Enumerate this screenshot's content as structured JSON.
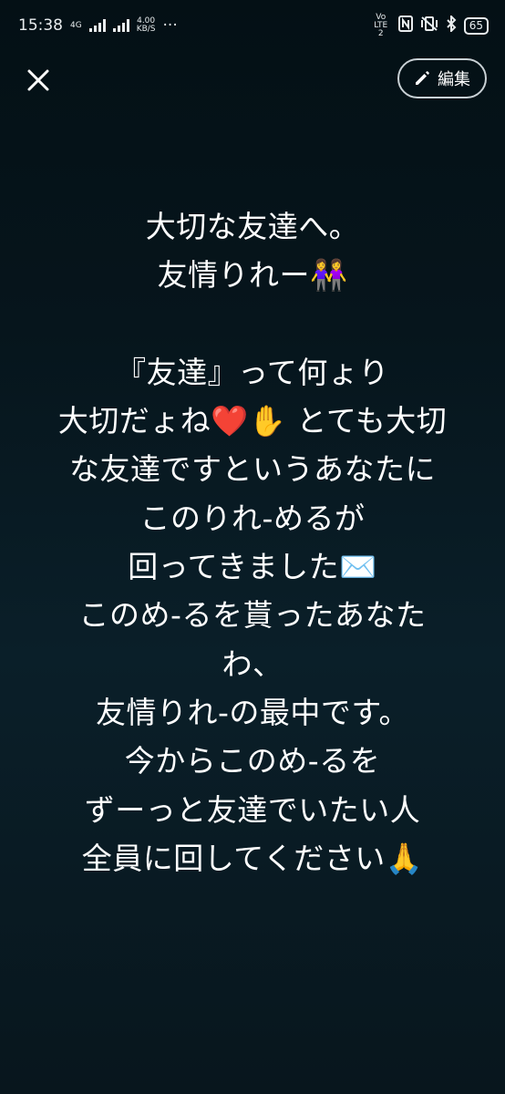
{
  "status_bar": {
    "time": "15:38",
    "network_type": "4G",
    "speed_value": "4.00",
    "speed_unit": "KB/S",
    "more": "···",
    "volte": "Vo LTE 2",
    "battery": "65"
  },
  "top_bar": {
    "edit_label": "編集"
  },
  "message": {
    "lines": [
      "大切な友達へ。",
      "友情りれー👭",
      "",
      "『友達』って何ょり",
      "大切だょね❤️✋ とても大切",
      "な友達ですというあなたに",
      "このりれ-めるが",
      "回ってきました✉️",
      "このめ-るを貰ったあなた",
      "わ、",
      "友情りれ-の最中です。",
      "今からこのめ-るを",
      "ずーっと友達でいたい人",
      "全員に回してください🙏"
    ]
  },
  "colors": {
    "background_top": "#041015",
    "background_mid": "#0a1f29",
    "text": "#ffffff",
    "button_border": "#c9d1d5"
  }
}
